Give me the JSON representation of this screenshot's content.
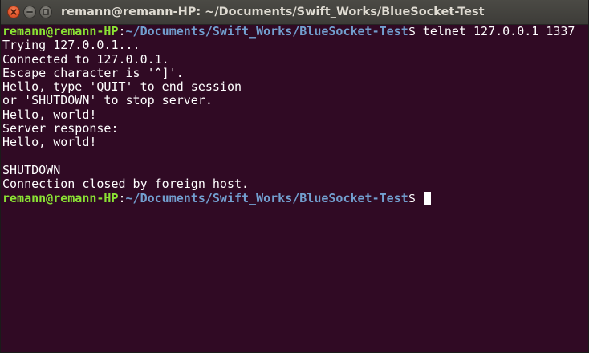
{
  "window": {
    "title": "remann@remann-HP: ~/Documents/Swift_Works/BlueSocket-Test",
    "buttons": {
      "close": "close-icon",
      "minimize": "minimize-icon",
      "maximize": "maximize-icon"
    }
  },
  "colors": {
    "background": "#300a24",
    "user_host": "#8ae234",
    "path": "#729fcf",
    "text": "#ffffff",
    "close_button": "#e0562c"
  },
  "terminal": {
    "prompt1": {
      "user_host": "remann@remann-HP",
      "colon": ":",
      "path": "~/Documents/Swift_Works/BlueSocket-Test",
      "symbol": "$ ",
      "command": "telnet 127.0.0.1 1337"
    },
    "output": [
      "Trying 127.0.0.1...",
      "Connected to 127.0.0.1.",
      "Escape character is '^]'.",
      "Hello, type 'QUIT' to end session",
      "or 'SHUTDOWN' to stop server.",
      "Hello, world!",
      "Server response:",
      "Hello, world!",
      "",
      "SHUTDOWN",
      "Connection closed by foreign host."
    ],
    "prompt2": {
      "user_host": "remann@remann-HP",
      "colon": ":",
      "path": "~/Documents/Swift_Works/BlueSocket-Test",
      "symbol": "$ ",
      "command": ""
    }
  }
}
